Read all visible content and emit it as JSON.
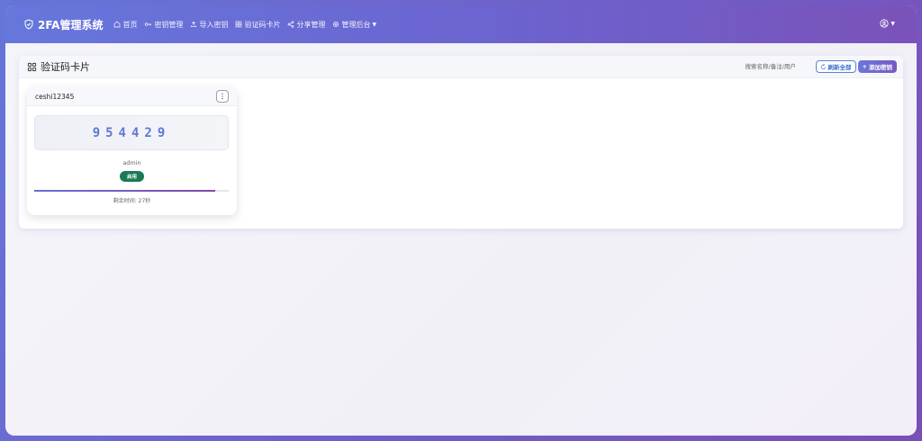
{
  "app": {
    "title": "2FA管理系统"
  },
  "nav": {
    "items": [
      {
        "label": "首页",
        "icon": "home-icon"
      },
      {
        "label": "密钥管理",
        "icon": "key-icon"
      },
      {
        "label": "导入密钥",
        "icon": "upload-icon"
      },
      {
        "label": "验证码卡片",
        "icon": "grid-icon"
      },
      {
        "label": "分享管理",
        "icon": "share-icon"
      },
      {
        "label": "管理后台",
        "icon": "gear-icon",
        "has_dropdown": true
      }
    ]
  },
  "user_menu": {
    "icon": "user-circle-icon"
  },
  "panel": {
    "title": "验证码卡片",
    "search_placeholder": "搜索名称/备注/用户",
    "refresh_label": "刷新全部",
    "add_label": "添加密钥"
  },
  "cards": [
    {
      "name": "ceshi12345",
      "code": "954429",
      "user": "admin",
      "status": "启用",
      "progress": 0.93,
      "remaining_text": "剩余时间: 27秒"
    }
  ],
  "colors": {
    "accent": "#6b6fd6",
    "status_enabled": "#1a7a55",
    "code_text": "#5f78d2"
  }
}
